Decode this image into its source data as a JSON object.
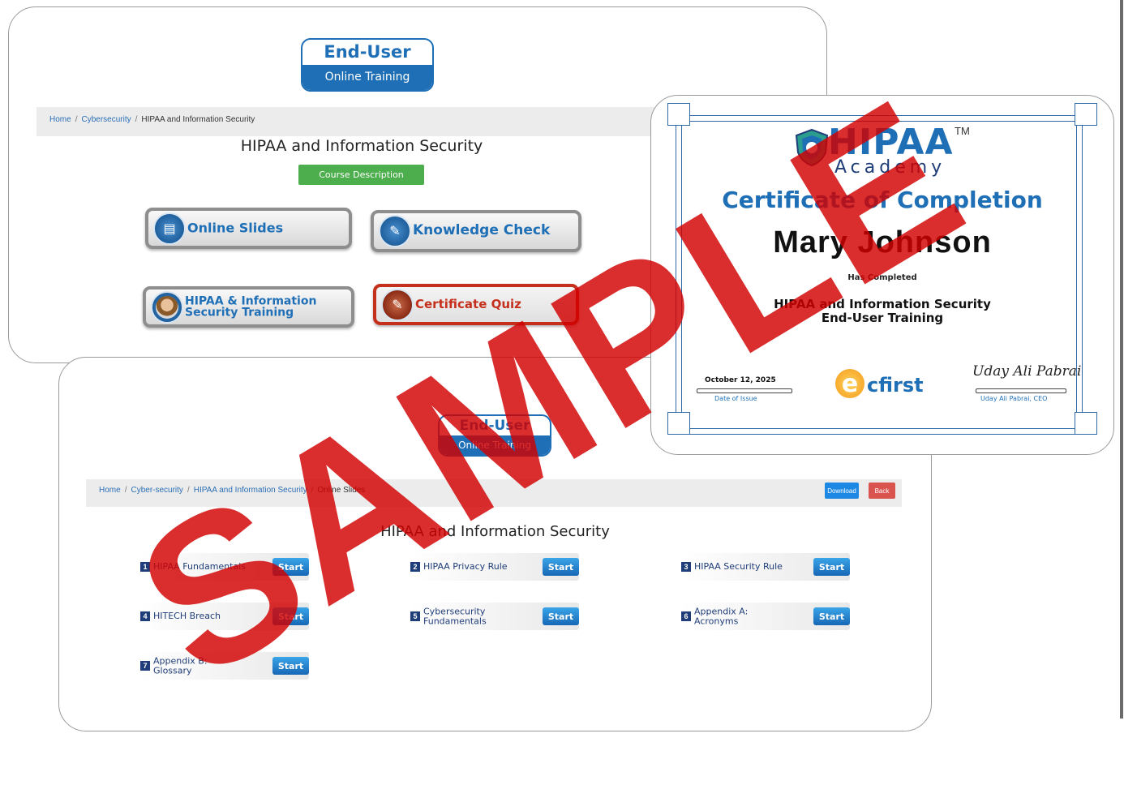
{
  "watermark": "SAMPLE",
  "logo": {
    "line1": "End-User",
    "line2": "Online Training"
  },
  "course_page": {
    "breadcrumb": [
      "Home",
      "Cybersecurity",
      "HIPAA and Information Security"
    ],
    "title": "HIPAA and Information Security",
    "course_description": "Course Description",
    "buttons": {
      "online_slides": "Online Slides",
      "knowledge_check": "Knowledge Check",
      "training_line1": "HIPAA & Information",
      "training_line2": "Security Training",
      "certificate_quiz": "Certificate Quiz"
    }
  },
  "slides_page": {
    "breadcrumb": [
      "Home",
      "Cyber-security",
      "HIPAA and Information Security",
      "Online Slides"
    ],
    "download": "Download",
    "back": "Back",
    "title": "HIPAA and Information Security",
    "start_label": "Start",
    "modules": [
      {
        "num": "1",
        "line1": "HIPAA Fundamentals",
        "line2": ""
      },
      {
        "num": "2",
        "line1": "HIPAA Privacy Rule",
        "line2": ""
      },
      {
        "num": "3",
        "line1": "HIPAA Security Rule",
        "line2": ""
      },
      {
        "num": "4",
        "line1": "HITECH Breach",
        "line2": ""
      },
      {
        "num": "5",
        "line1": "Cybersecurity",
        "line2": "Fundamentals"
      },
      {
        "num": "6",
        "line1": "Appendix A:",
        "line2": "Acronyms"
      },
      {
        "num": "7",
        "line1": "Appendix B:",
        "line2": "Glossary"
      }
    ]
  },
  "certificate": {
    "brand": "HIPAA",
    "tm": "TM",
    "academy": "Academy",
    "title": "Certificate of Completion",
    "name": "Mary Johnson",
    "has_completed": "Has Completed",
    "course_line1": "HIPAA and Information Security",
    "course_line2": "End-User Training",
    "date": "October 12, 2025",
    "date_label": "Date of Issue",
    "issuer_e": "e",
    "issuer": "cfirst",
    "signature": "Uday Ali Pabrai",
    "signer_label": "Uday Ali Pabrai, CEO"
  },
  "colors": {
    "brand_blue": "#1e6fb6",
    "navy": "#1f3d78",
    "green": "#4cae4c",
    "red": "#c5301d",
    "watermark": "#d20000"
  }
}
